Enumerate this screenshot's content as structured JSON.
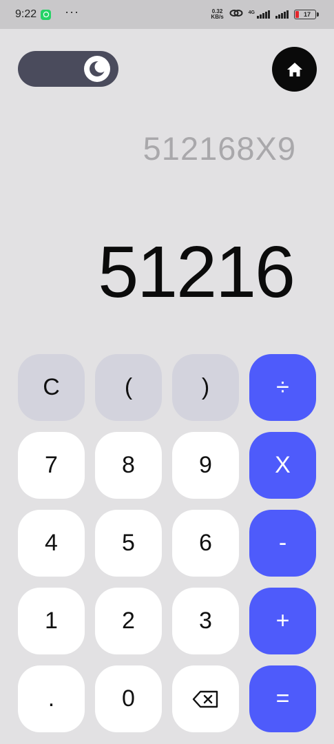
{
  "status_bar": {
    "time": "9:22",
    "more": "···",
    "net_speed_value": "0.32",
    "net_speed_unit": "KB/s",
    "network_type": "4G",
    "battery_level": "17",
    "icons": [
      "whatsapp-icon",
      "hotspot-link-icon",
      "signal-icon",
      "signal-icon",
      "battery-icon"
    ],
    "battery_color": "#e3262b"
  },
  "header": {
    "theme_toggle_icon": "moon-icon",
    "home_icon": "home-icon"
  },
  "display": {
    "expression": "512168X9",
    "result": "51216"
  },
  "keypad": {
    "rows": [
      [
        {
          "label": "C",
          "type": "func",
          "name": "clear"
        },
        {
          "label": "(",
          "type": "func",
          "name": "open-paren"
        },
        {
          "label": ")",
          "type": "func",
          "name": "close-paren"
        },
        {
          "label": "÷",
          "type": "op",
          "name": "divide"
        }
      ],
      [
        {
          "label": "7",
          "type": "num",
          "name": "7"
        },
        {
          "label": "8",
          "type": "num",
          "name": "8"
        },
        {
          "label": "9",
          "type": "num",
          "name": "9"
        },
        {
          "label": "X",
          "type": "op",
          "name": "multiply"
        }
      ],
      [
        {
          "label": "4",
          "type": "num",
          "name": "4"
        },
        {
          "label": "5",
          "type": "num",
          "name": "5"
        },
        {
          "label": "6",
          "type": "num",
          "name": "6"
        },
        {
          "label": "-",
          "type": "op",
          "name": "subtract"
        }
      ],
      [
        {
          "label": "1",
          "type": "num",
          "name": "1"
        },
        {
          "label": "2",
          "type": "num",
          "name": "2"
        },
        {
          "label": "3",
          "type": "num",
          "name": "3"
        },
        {
          "label": "+",
          "type": "op",
          "name": "add"
        }
      ],
      [
        {
          "label": ".",
          "type": "num",
          "name": "decimal"
        },
        {
          "label": "0",
          "type": "num",
          "name": "0"
        },
        {
          "label": "",
          "type": "num",
          "name": "backspace",
          "icon": "backspace-icon"
        },
        {
          "label": "=",
          "type": "op",
          "name": "equals"
        }
      ]
    ]
  },
  "colors": {
    "background": "#e2e1e3",
    "operator": "#4e5bfb",
    "function_key": "#d3d3dd",
    "number_key": "#ffffff",
    "toggle": "#4a4b5c"
  }
}
